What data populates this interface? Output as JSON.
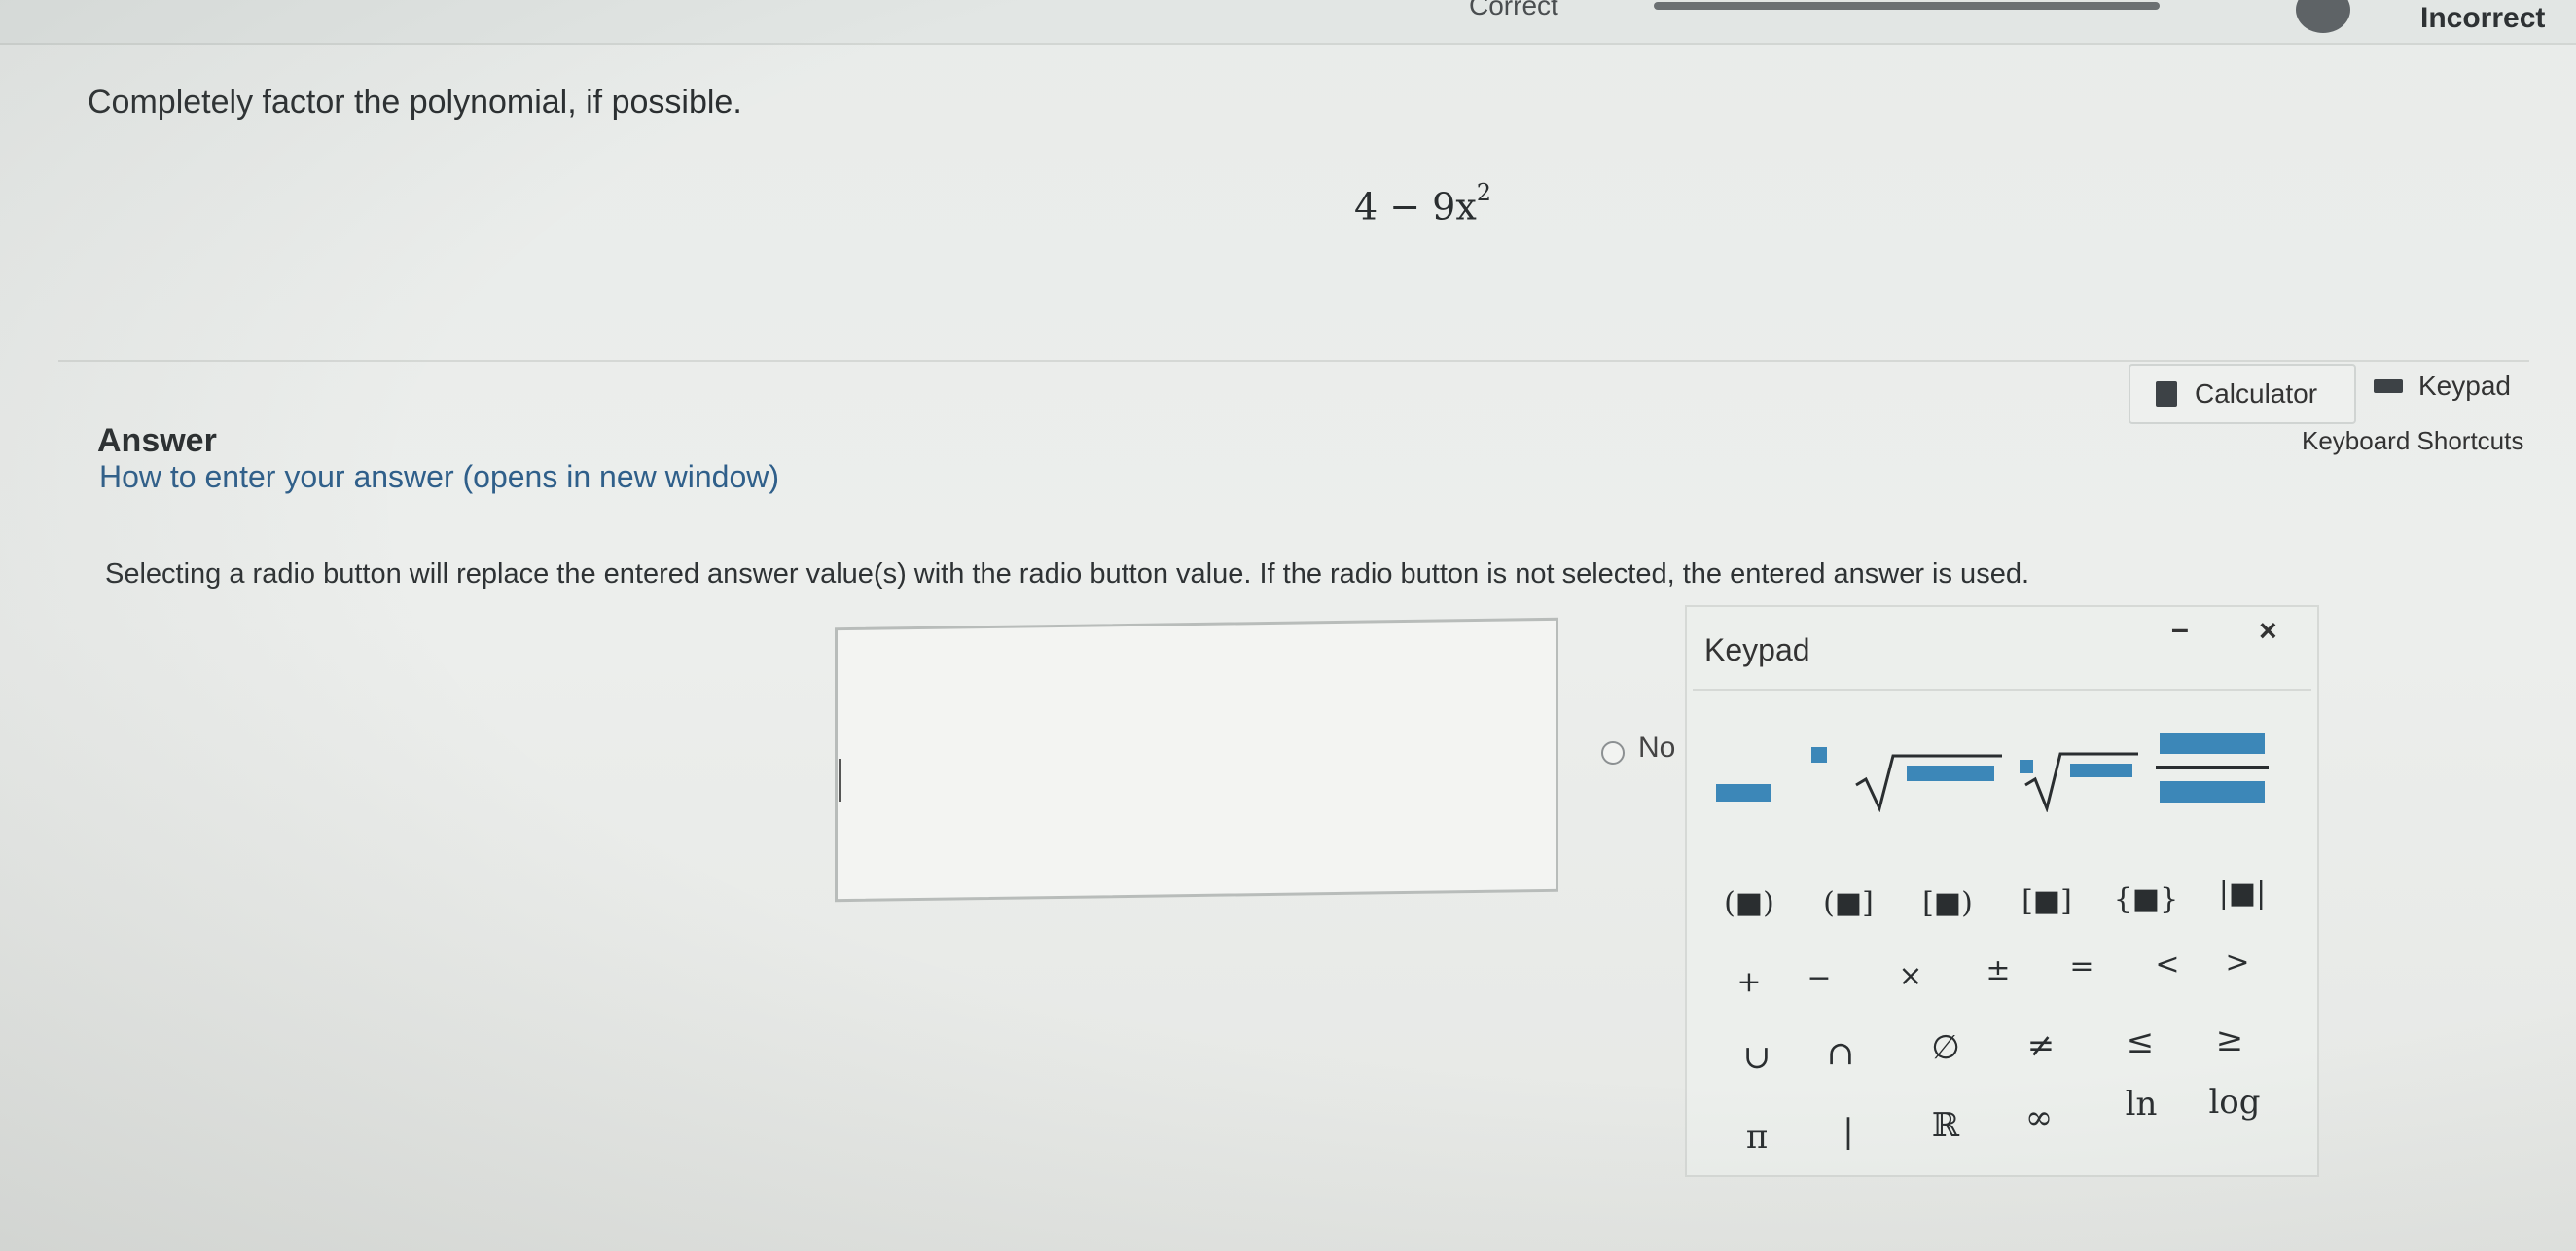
{
  "top": {
    "correct_label": "Correct",
    "incorrect_label": "Incorrect"
  },
  "question": {
    "prompt": "Completely factor the polynomial, if possible.",
    "expression_base": "4 − 9x",
    "expression_exp": "2"
  },
  "answer": {
    "title": "Answer",
    "how_to_link": "How to enter your answer (opens in new window)",
    "instructions": "Selecting a radio button will replace the entered answer value(s) with the radio button value. If the radio button is not selected, the entered answer is used.",
    "input_value": "",
    "radio_label": "No"
  },
  "tools": {
    "calculator_label": "Calculator",
    "keypad_label": "Keypad",
    "shortcuts_label": "Keyboard Shortcuts"
  },
  "keypad": {
    "title": "Keypad",
    "minimize": "–",
    "close": "×",
    "brackets": [
      "(■)",
      "(■]",
      "[■)",
      "[■]",
      "{■}",
      "|■|"
    ],
    "operators": [
      "+",
      "−",
      "×",
      "±",
      "=",
      "<",
      ">"
    ],
    "sets": [
      "∪",
      "∩",
      "∅",
      "≠",
      "≤",
      "≥"
    ],
    "constants": [
      "π",
      "|",
      "ℝ",
      "∞",
      "ln",
      "log"
    ]
  }
}
